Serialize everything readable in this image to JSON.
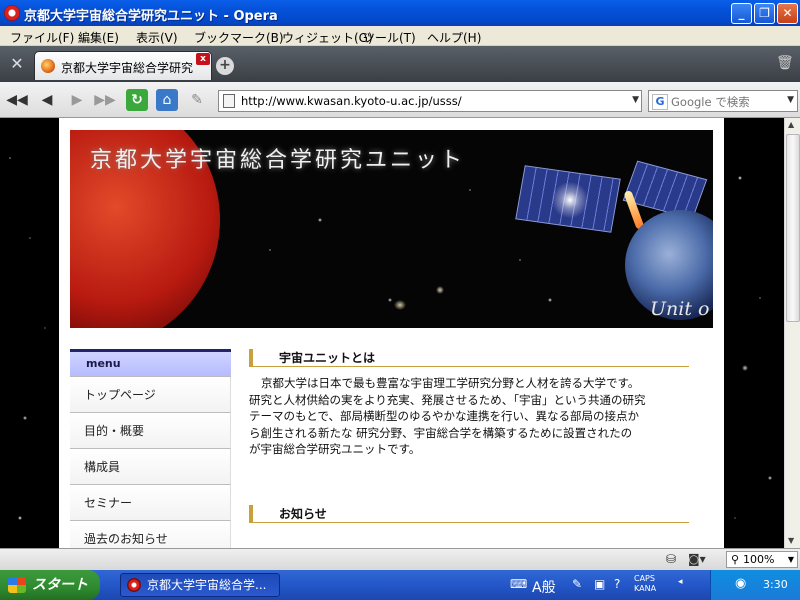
{
  "window": {
    "title": "京都大学宇宙総合学研究ユニット - Opera"
  },
  "menubar": {
    "items": [
      "ファイル(F)",
      "編集(E)",
      "表示(V)",
      "ブックマーク(B)",
      "ウィジェット(G)",
      "ツール(T)",
      "ヘルプ(H)"
    ]
  },
  "tab": {
    "label": "京都大学宇宙総合学研究ユニット",
    "close": "x",
    "newtab": "+"
  },
  "address": {
    "url": "http://www.kwasan.kyoto-u.ac.jp/usss/",
    "search_placeholder": "Google で検索"
  },
  "banner": {
    "title": "京都大学宇宙総合学研究ユニット",
    "subtitle": "Unit o"
  },
  "sidemenu": {
    "heading": "menu",
    "items": [
      "トップページ",
      "目的・概要",
      "構成員",
      "セミナー",
      "過去のお知らせ"
    ]
  },
  "main": {
    "section1_title": "宇宙ユニットとは",
    "intro_lines": [
      "京都大学は日本で最も豊富な宇宙理工学研究分野と人材を誇る大学です。",
      "研究と人材供給の実をより充実、発展させるため、「宇宙」という共通の研究",
      "テーマのもとで、部局横断型のゆるやかな連携を行い、異なる部局の接点か",
      "ら創生される新たな 研究分野、宇宙総合学を構築するために設置されたの",
      "が宇宙総合学研究ユニットです。"
    ],
    "section2_title": "お知らせ"
  },
  "statusbar": {
    "zoom": "100%"
  },
  "taskbar": {
    "start": "スタート",
    "task_label": "京都大学宇宙総合学...",
    "ime_mode": "A般",
    "caps": "CAPS",
    "kana": "KANA",
    "clock": "3:30"
  },
  "colors": {
    "menu_accent": "#23236a",
    "section_accent": "#c8a03c",
    "xp_blue": "#0451d8"
  }
}
